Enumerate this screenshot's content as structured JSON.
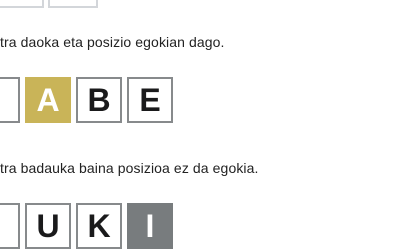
{
  "examples": [
    {
      "caption": "tra daoka eta posizio egokian dago.",
      "tiles": [
        {
          "letter": "",
          "state": "empty"
        },
        {
          "letter": "A",
          "state": "present"
        },
        {
          "letter": "B",
          "state": "empty"
        },
        {
          "letter": "E",
          "state": "empty"
        }
      ]
    },
    {
      "caption": "tra badauka baina posizioa ez da egokia.",
      "tiles": [
        {
          "letter": "",
          "state": "empty"
        },
        {
          "letter": "U",
          "state": "empty"
        },
        {
          "letter": "K",
          "state": "empty"
        },
        {
          "letter": "I",
          "state": "absent"
        }
      ]
    }
  ],
  "colors": {
    "present": "#c9b458",
    "absent": "#787c7e",
    "border": "#878a8c"
  }
}
